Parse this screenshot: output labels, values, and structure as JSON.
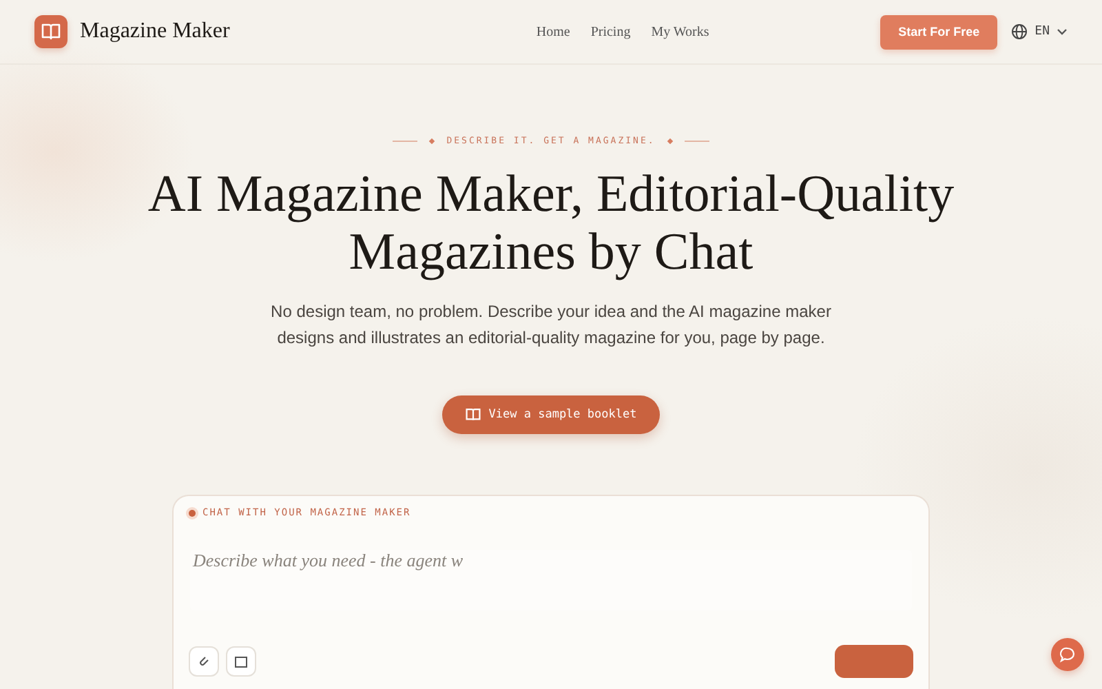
{
  "nav": {
    "brand": "Magazine Maker",
    "links": [
      "Home",
      "Pricing",
      "My Works"
    ],
    "cta": "Start For Free",
    "language": "EN"
  },
  "hero": {
    "eyebrow": "DESCRIBE IT. GET A MAGAZINE.",
    "title_lines": [
      "AI Magazine Maker, Editorial-Quality",
      "Magazines by Chat"
    ],
    "subtitle_lines": [
      "No design team, no problem. Describe your idea and the AI magazine maker",
      "designs and illustrates an editorial-quality magazine for you, page by page."
    ],
    "sample_button": "View a sample booklet"
  },
  "chat": {
    "label": "CHAT WITH YOUR MAGAZINE MAKER",
    "placeholder": "Describe what you need - the agent w"
  }
}
